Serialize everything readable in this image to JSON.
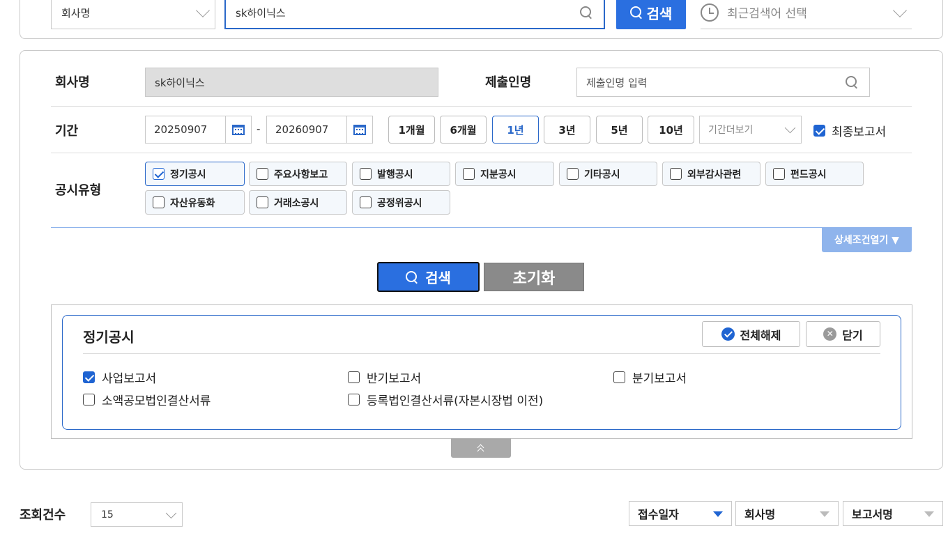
{
  "top_search": {
    "category_select": "회사명",
    "query_value": "sk하이닉스",
    "search_button": "검색",
    "recent_search_placeholder": "최근검색어 선택"
  },
  "form": {
    "company_label": "회사명",
    "company_value": "sk하이닉스",
    "submitter_label": "제출인명",
    "submitter_placeholder": "제출인명 입력",
    "period_label": "기간",
    "start_date": "20250907",
    "date_separator": "-",
    "end_date": "20260907",
    "period_buttons": [
      "1개월",
      "6개월",
      "1년",
      "3년",
      "5년",
      "10년"
    ],
    "active_period": "1년",
    "period_more": "기간더보기",
    "final_report_label": "최종보고서",
    "final_report_checked": true,
    "disclosure_type_label": "공시유형",
    "disclosure_types": [
      {
        "label": "정기공시",
        "checked": true
      },
      {
        "label": "주요사항보고",
        "checked": false
      },
      {
        "label": "발행공시",
        "checked": false
      },
      {
        "label": "지분공시",
        "checked": false
      },
      {
        "label": "기타공시",
        "checked": false
      },
      {
        "label": "외부감사관련",
        "checked": false
      },
      {
        "label": "펀드공시",
        "checked": false
      },
      {
        "label": "자산유동화",
        "checked": false
      },
      {
        "label": "거래소공시",
        "checked": false
      },
      {
        "label": "공정위공시",
        "checked": false
      }
    ],
    "detail_toggle": "상세조건열기 ▼",
    "search_button": "검색",
    "reset_button": "초기화"
  },
  "detail_panel": {
    "title": "정기공시",
    "clear_all_button": "전체해제",
    "close_button": "닫기",
    "options": [
      {
        "label": "사업보고서",
        "checked": true
      },
      {
        "label": "반기보고서",
        "checked": false
      },
      {
        "label": "분기보고서",
        "checked": false
      },
      {
        "label": "소액공모법인결산서류",
        "checked": false
      },
      {
        "label": "등록법인결산서류(자본시장법 이전)",
        "checked": false
      }
    ],
    "collapse_glyph": "≈"
  },
  "results_bar": {
    "count_label": "조회건수",
    "count_value": "15",
    "sort_buttons": [
      {
        "label": "접수일자",
        "active": true
      },
      {
        "label": "회사명",
        "active": false
      },
      {
        "label": "보고서명",
        "active": false
      }
    ]
  },
  "colors": {
    "accent": "#2a6fe0",
    "reset_gray": "#8a8a8a",
    "detail_toggle_bg": "#8fb4ec"
  }
}
